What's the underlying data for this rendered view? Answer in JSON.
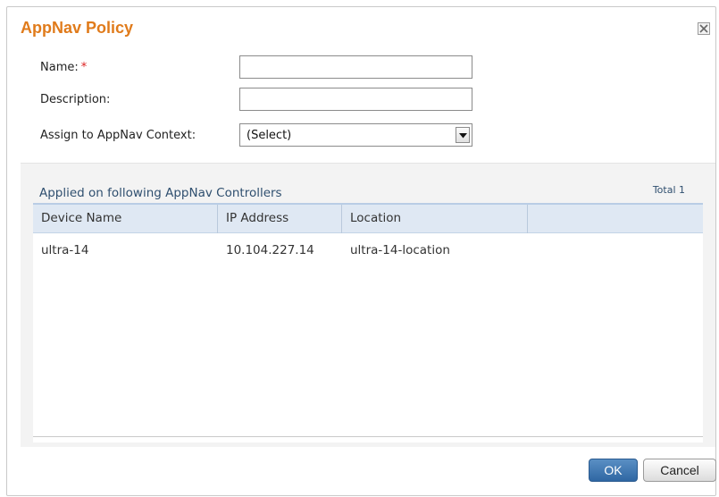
{
  "dialog": {
    "title": "AppNav Policy",
    "close_icon": "close-icon"
  },
  "form": {
    "name_label": "Name:",
    "required_marker": "*",
    "name_value": "",
    "description_label": "Description:",
    "description_value": "",
    "context_label": "Assign to AppNav Context:",
    "context_selected": "(Select)"
  },
  "controllers": {
    "title": "Applied on following AppNav Controllers",
    "total": "Total 1",
    "columns": [
      "Device Name",
      "IP Address",
      "Location"
    ],
    "rows": [
      [
        "ultra-14",
        "10.104.227.14",
        "ultra-14-location"
      ]
    ]
  },
  "buttons": {
    "ok": "OK",
    "cancel": "Cancel"
  },
  "colors": {
    "title": "#e07b1b",
    "required": "#dd2222",
    "header_bg": "#dfe8f3",
    "ok_button": "#2f67a3"
  }
}
